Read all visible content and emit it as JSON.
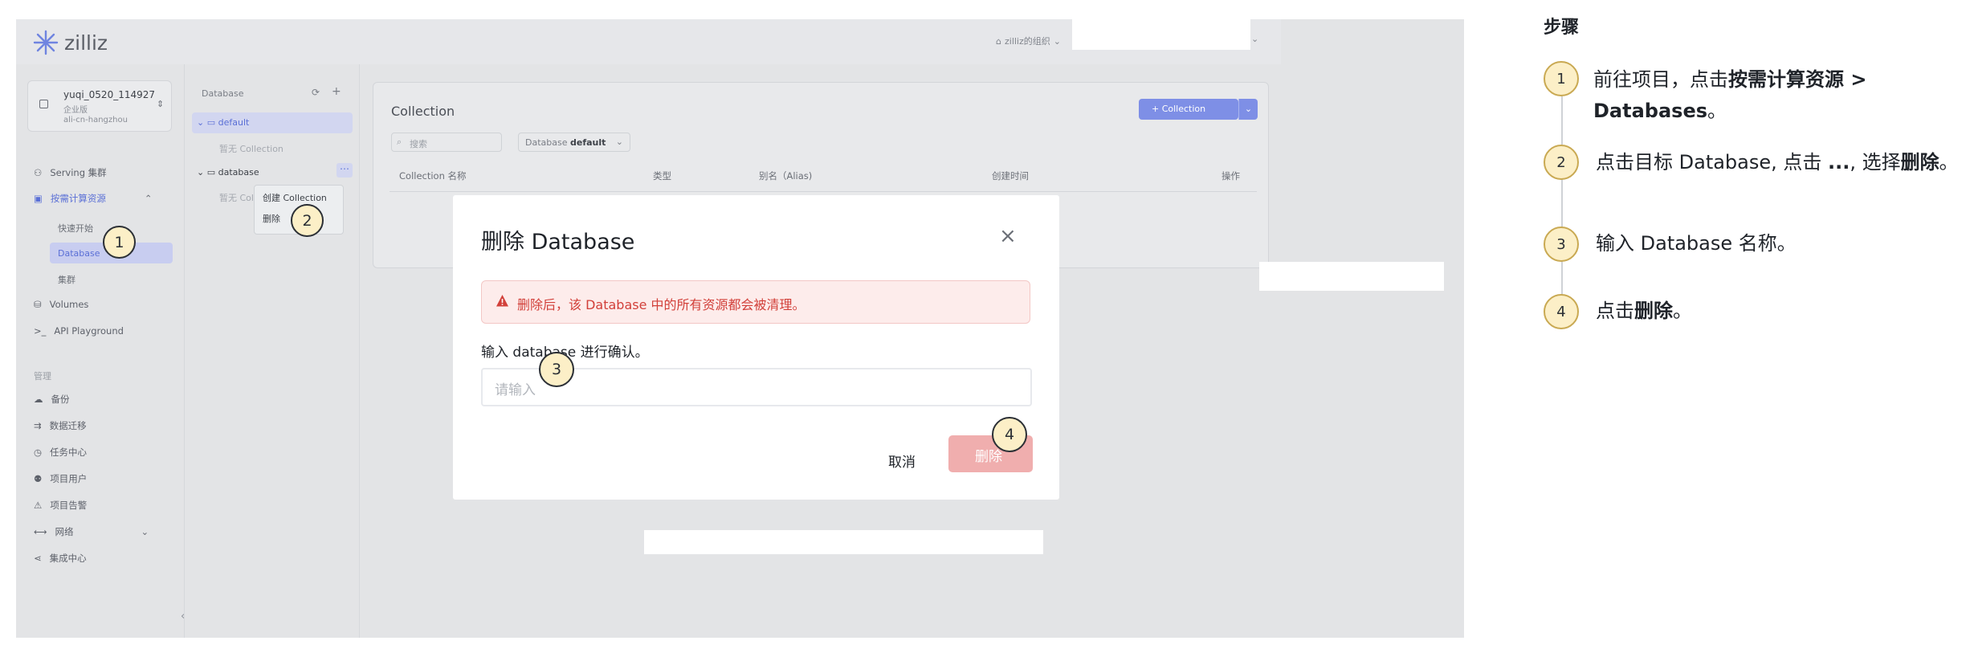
{
  "app": {
    "logo_text": "zilliz",
    "org_label": "zilliz的组织"
  },
  "sidebar": {
    "project_name": "yuqi_0520_114927",
    "project_plan": "企业版",
    "project_region": "ali-cn-hangzhou",
    "items": [
      {
        "label": "Serving 集群"
      },
      {
        "label": "按需计算资源"
      },
      {
        "label": "快速开始"
      },
      {
        "label": "Database"
      },
      {
        "label": "集群"
      },
      {
        "label": "Volumes"
      },
      {
        "label": "API Playground"
      }
    ],
    "section_label": "管理",
    "manage_items": [
      {
        "label": "备份"
      },
      {
        "label": "数据迁移"
      },
      {
        "label": "任务中心"
      },
      {
        "label": "项目用户"
      },
      {
        "label": "项目告警"
      },
      {
        "label": "网络"
      },
      {
        "label": "集成中心"
      }
    ]
  },
  "tree": {
    "title": "Database",
    "db_default": "default",
    "placeholder_default": "暂无 Collection",
    "db_database": "database",
    "placeholder_database": "暂无 Colle",
    "menu_create": "创建 Collection",
    "menu_delete": "删除"
  },
  "panel": {
    "title": "Collection",
    "add_button": "+ Collection",
    "search_placeholder": "搜索",
    "db_select_label": "Database",
    "db_select_value": "default",
    "columns": [
      "Collection 名称",
      "类型",
      "别名（Alias)",
      "创建时间",
      "操作"
    ]
  },
  "modal": {
    "title": "删除 Database",
    "close_glyph": "×",
    "warning": "删除后，该 Database 中的所有资源都会被清理。",
    "confirm_label": "输入 database 进行确认。",
    "input_placeholder": "请输入",
    "cancel_button": "取消",
    "delete_button": "删除"
  },
  "markers": [
    "1",
    "2",
    "3",
    "4"
  ],
  "steps": {
    "title": "步骤",
    "items": [
      {
        "num": "1",
        "pre": "前往项目，点击",
        "bold": "按需计算资源 > Databases",
        "post": "。"
      },
      {
        "num": "2",
        "pre": "点击目标 Database, 点击 ",
        "bold": "...",
        "mid": ", 选择",
        "bold2": "删除",
        "post": "。"
      },
      {
        "num": "3",
        "pre": "输入 Database 名称。"
      },
      {
        "num": "4",
        "pre": "点击",
        "bold": "删除",
        "post": "。"
      }
    ]
  },
  "colors": {
    "accent": "#5a6fd6",
    "danger": "#d2403a",
    "delete_disabled": "#f0aeae",
    "marker_fill": "#fcefc7"
  }
}
